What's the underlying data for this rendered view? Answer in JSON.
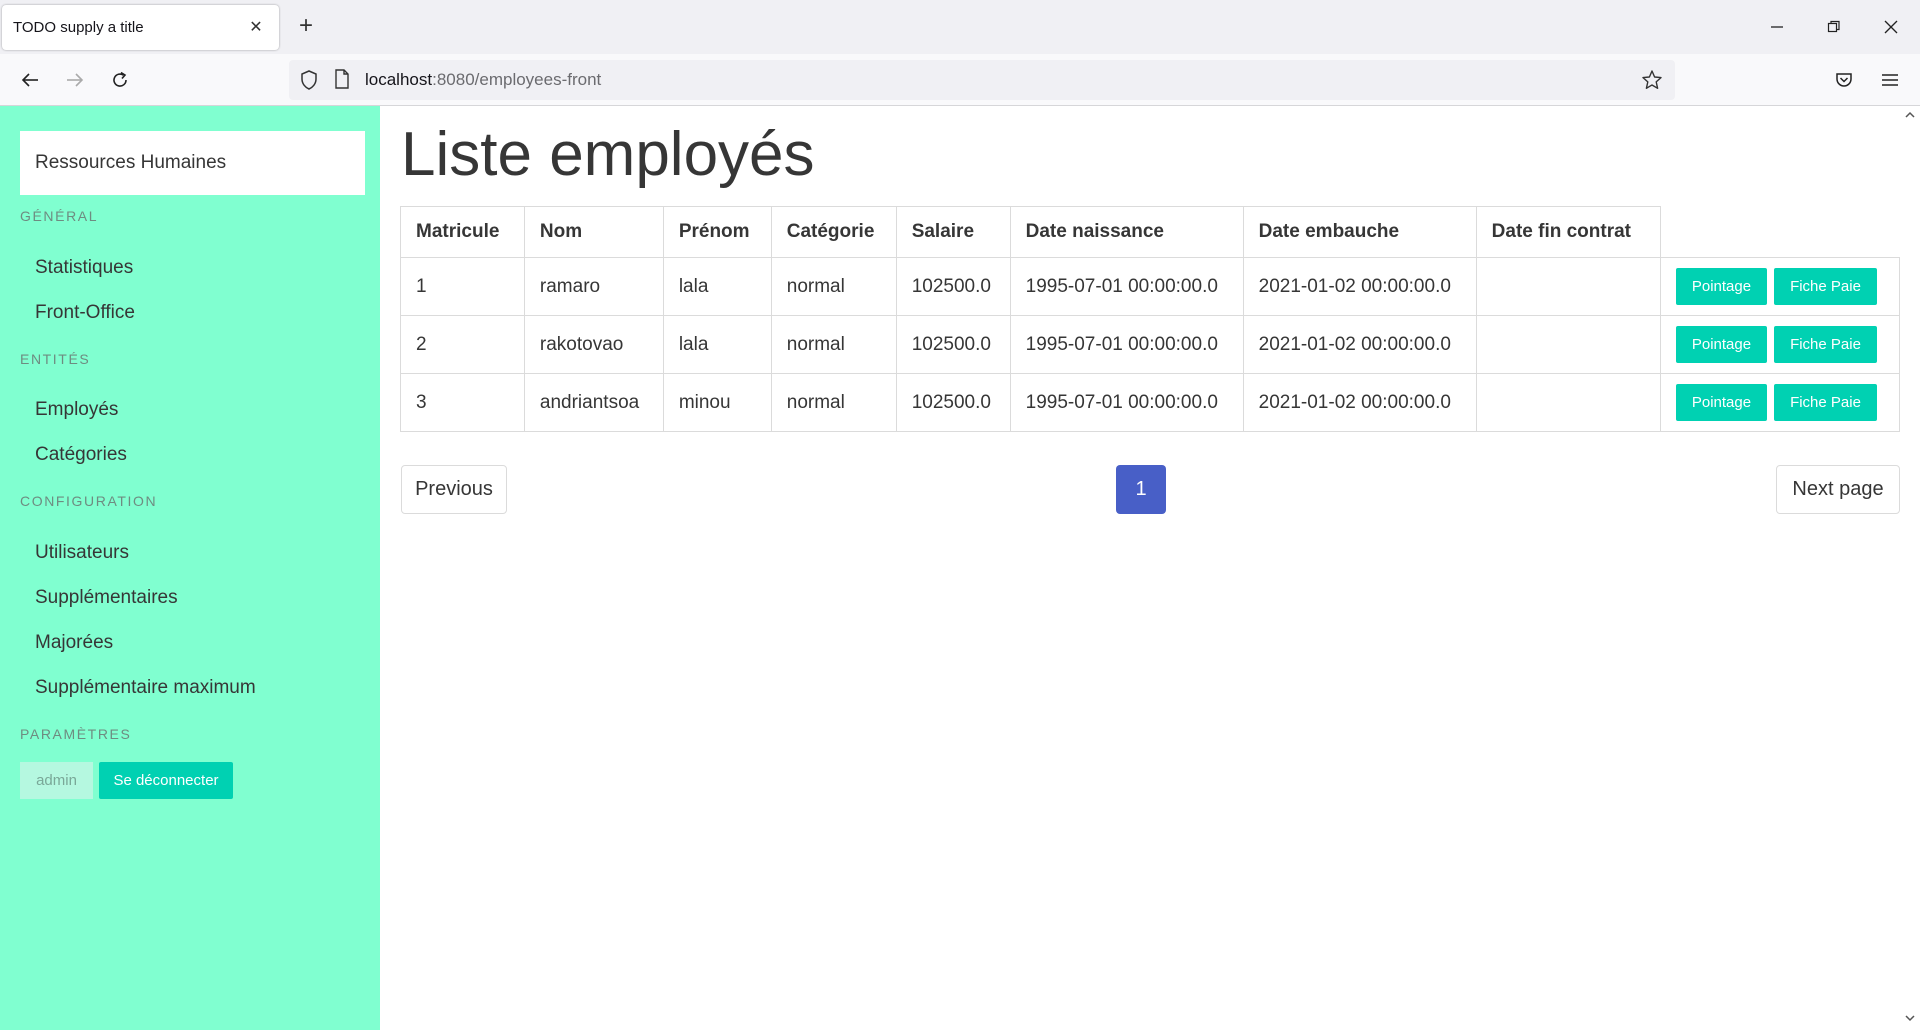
{
  "browser": {
    "tab_title": "TODO supply a title",
    "url_host": "localhost",
    "url_rest": ":8080/employees-front"
  },
  "sidebar": {
    "brand": "Ressources Humaines",
    "sections": [
      {
        "label": "Général",
        "items": [
          "Statistiques",
          "Front-Office"
        ]
      },
      {
        "label": "Entités",
        "items": [
          "Employés",
          "Catégories"
        ]
      },
      {
        "label": "Configuration",
        "items": [
          "Utilisateurs",
          "Supplémentaires",
          "Majorées",
          "Supplémentaire maximum"
        ]
      },
      {
        "label": "Paramètres",
        "items": []
      }
    ],
    "user_tag": "admin",
    "logout_label": "Se déconnecter"
  },
  "main": {
    "title": "Liste employés",
    "columns": [
      "Matricule",
      "Nom",
      "Prénom",
      "Catégorie",
      "Salaire",
      "Date naissance",
      "Date embauche",
      "Date fin contrat"
    ],
    "rows": [
      {
        "matricule": "1",
        "nom": "ramaro",
        "prenom": "lala",
        "categorie": "normal",
        "salaire": "102500.0",
        "date_naissance": "1995-07-01 00:00:00.0",
        "date_embauche": "2021-01-02 00:00:00.0",
        "date_fin": ""
      },
      {
        "matricule": "2",
        "nom": "rakotovao",
        "prenom": "lala",
        "categorie": "normal",
        "salaire": "102500.0",
        "date_naissance": "1995-07-01 00:00:00.0",
        "date_embauche": "2021-01-02 00:00:00.0",
        "date_fin": ""
      },
      {
        "matricule": "3",
        "nom": "andriantsoa",
        "prenom": "minou",
        "categorie": "normal",
        "salaire": "102500.0",
        "date_naissance": "1995-07-01 00:00:00.0",
        "date_embauche": "2021-01-02 00:00:00.0",
        "date_fin": ""
      }
    ],
    "row_actions": {
      "pointage": "Pointage",
      "fiche_paie": "Fiche Paie"
    },
    "pagination": {
      "previous": "Previous",
      "current": "1",
      "next": "Next page"
    }
  },
  "colors": {
    "sidebar_bg": "#80ffd0",
    "primary_teal": "#00d1b2",
    "pagination_active": "#485fc7"
  }
}
